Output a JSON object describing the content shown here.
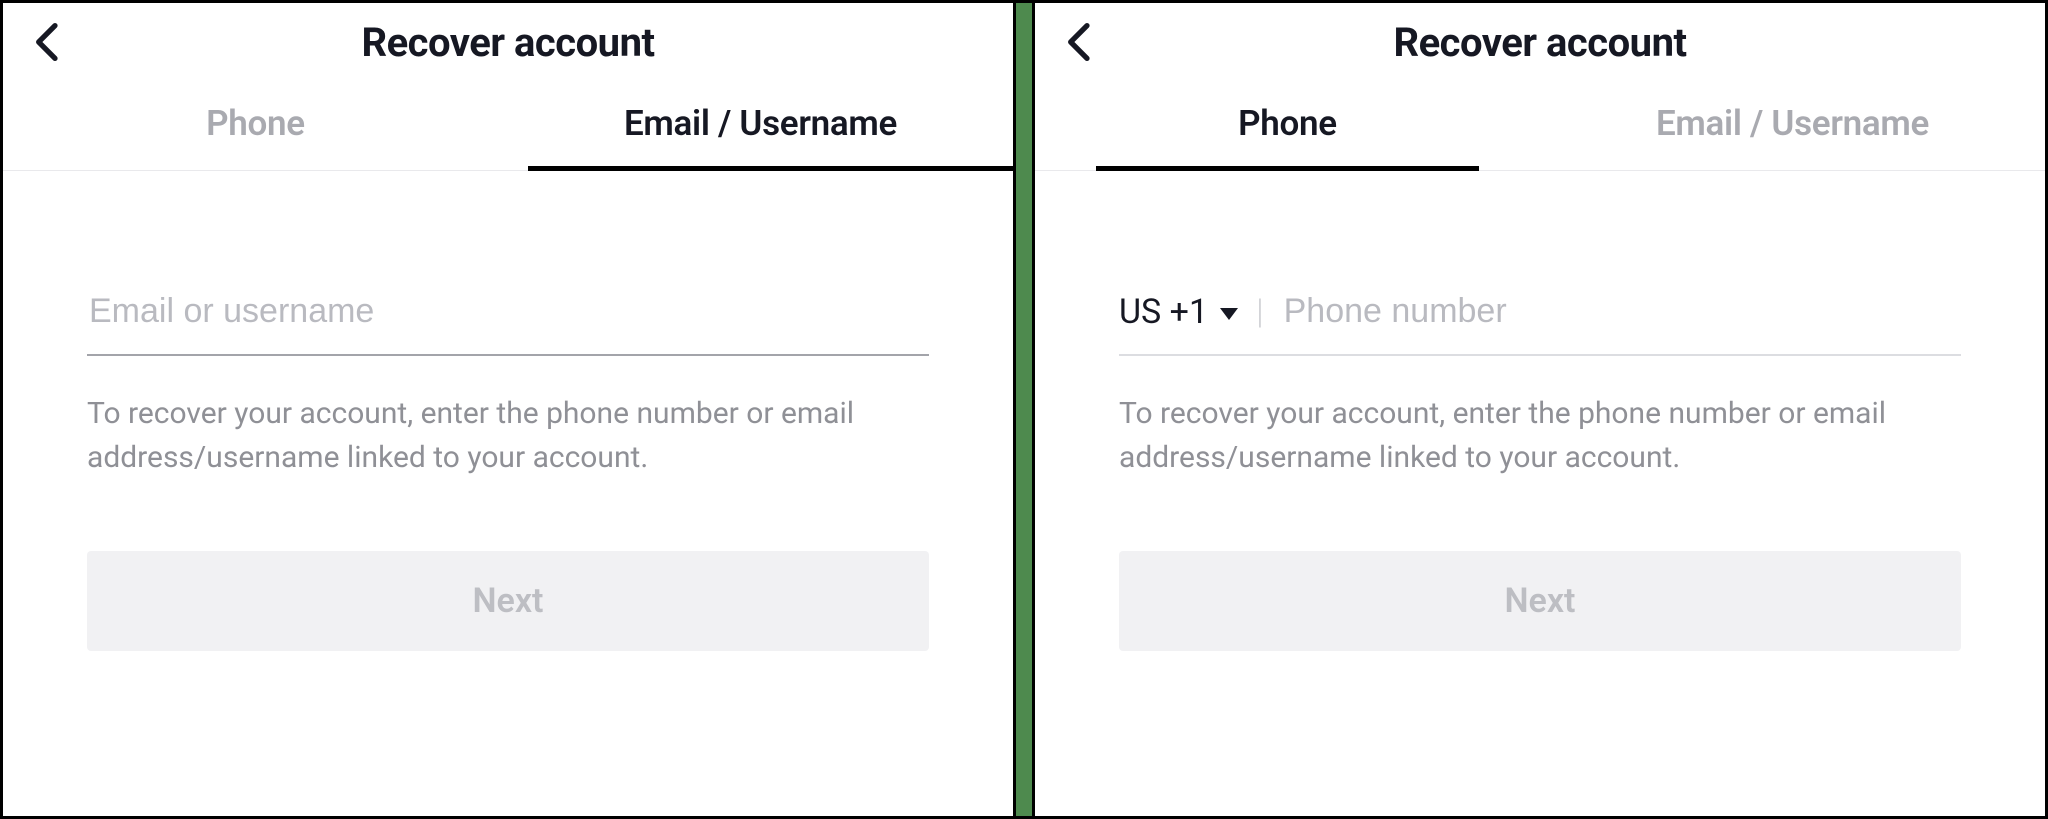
{
  "left": {
    "header": {
      "title": "Recover account"
    },
    "tabs": {
      "phone": "Phone",
      "email": "Email / Username"
    },
    "field": {
      "placeholder": "Email or username",
      "value": ""
    },
    "helper": "To recover your account, enter the phone number or email address/username linked to your account.",
    "next_label": "Next"
  },
  "right": {
    "header": {
      "title": "Recover account"
    },
    "tabs": {
      "phone": "Phone",
      "email": "Email / Username"
    },
    "field": {
      "country_code": "US +1",
      "placeholder": "Phone number",
      "value": ""
    },
    "helper": "To recover your account, enter the phone number or email address/username linked to your account.",
    "next_label": "Next"
  }
}
